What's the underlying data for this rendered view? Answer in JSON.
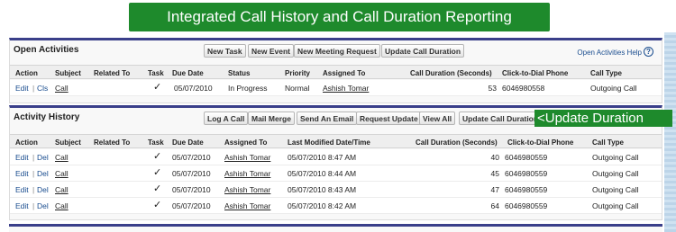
{
  "banner": "Integrated Call History and Call Duration Reporting",
  "annotation": "<Update Duration",
  "open_activities": {
    "title": "Open Activities",
    "buttons": [
      "New Task",
      "New Event",
      "New Meeting Request",
      "Update Call Duration"
    ],
    "help": "Open Activities Help",
    "help_icon": "?",
    "headers": [
      "Action",
      "Subject",
      "Related To",
      "Task",
      "Due Date",
      "Status",
      "Priority",
      "Assigned To",
      "Call Duration (Seconds)",
      "Click-to-Dial Phone",
      "Call Type"
    ],
    "rows": [
      {
        "edit": "Edit",
        "sep": "|",
        "action2": "Cls",
        "subject": "Call",
        "task": "✓",
        "due": "05/07/2010",
        "status": "In Progress",
        "priority": "Normal",
        "assigned": "Ashish Tomar",
        "duration": "53",
        "phone": "6046980558",
        "type": "Outgoing Call"
      }
    ]
  },
  "activity_history": {
    "title": "Activity History",
    "buttons": [
      "Log A Call",
      "Mail Merge",
      "Send An Email",
      "Request Update",
      "View All",
      "Update Call Duration"
    ],
    "headers": [
      "Action",
      "Subject",
      "Related To",
      "Task",
      "Due Date",
      "Assigned To",
      "Last Modified Date/Time",
      "Call Duration (Seconds)",
      "Click-to-Dial Phone",
      "Call Type"
    ],
    "rows": [
      {
        "edit": "Edit",
        "sep": "|",
        "action2": "Del",
        "subject": "Call",
        "task": "✓",
        "due": "05/07/2010",
        "assigned": "Ashish Tomar",
        "modified": "05/07/2010 8:47 AM",
        "duration": "40",
        "phone": "6046980559",
        "type": "Outgoing Call"
      },
      {
        "edit": "Edit",
        "sep": "|",
        "action2": "Del",
        "subject": "Call",
        "task": "✓",
        "due": "05/07/2010",
        "assigned": "Ashish Tomar",
        "modified": "05/07/2010 8:44 AM",
        "duration": "45",
        "phone": "6046980559",
        "type": "Outgoing Call"
      },
      {
        "edit": "Edit",
        "sep": "|",
        "action2": "Del",
        "subject": "Call",
        "task": "✓",
        "due": "05/07/2010",
        "assigned": "Ashish Tomar",
        "modified": "05/07/2010 8:43 AM",
        "duration": "47",
        "phone": "6046980559",
        "type": "Outgoing Call"
      },
      {
        "edit": "Edit",
        "sep": "|",
        "action2": "Del",
        "subject": "Call",
        "task": "✓",
        "due": "05/07/2010",
        "assigned": "Ashish Tomar",
        "modified": "05/07/2010 8:42 AM",
        "duration": "64",
        "phone": "6046980559",
        "type": "Outgoing Call"
      }
    ]
  }
}
